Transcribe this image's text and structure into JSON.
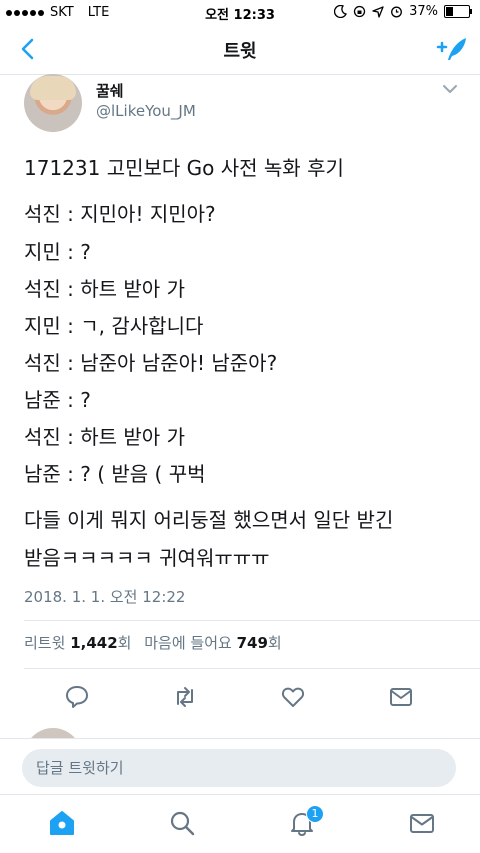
{
  "status_bar": {
    "carrier": "SKT",
    "network": "LTE",
    "time": "오전 12:33",
    "battery": "37%",
    "battery_fraction": 0.37
  },
  "nav": {
    "title": "트윗",
    "back_icon": "chevron-left-icon",
    "compose_icon": "compose-tweet-icon"
  },
  "tweet": {
    "display_name": "꿀쉐",
    "handle": "@lLikeYou_JM",
    "lines": [
      "171231 고민보다 Go 사전 녹화 후기",
      "석진 : 지민아! 지민아?",
      "지민 : ?",
      "석진 : 하트 받아 가",
      "지민 : ㄱ, 감사합니다",
      "석진 : 남준아 남준아! 남준아?",
      "남준 : ?",
      "석진 : 하트 받아 가",
      "남준 : ? ( 받음 ( 꾸벅",
      "다들 이게 뭐지 어리둥절 했으면서 일단 받긴",
      "받음ㅋㅋㅋㅋㅋ 귀여워ㅠㅠㅠ"
    ],
    "timestamp": "2018. 1. 1. 오전 12:22",
    "stats": {
      "retweet_label": "리트윗",
      "retweet_count": "1,442",
      "retweet_unit": "회",
      "like_label": "마음에 들어요",
      "like_count": "749",
      "like_unit": "회"
    }
  },
  "reply": {
    "placeholder": "답글 트윗하기"
  },
  "tab_bar": {
    "notification_badge": "1"
  },
  "colors": {
    "accent": "#1da1f2",
    "text": "#14171a",
    "secondary": "#657786",
    "divider": "#e1e8ed"
  }
}
